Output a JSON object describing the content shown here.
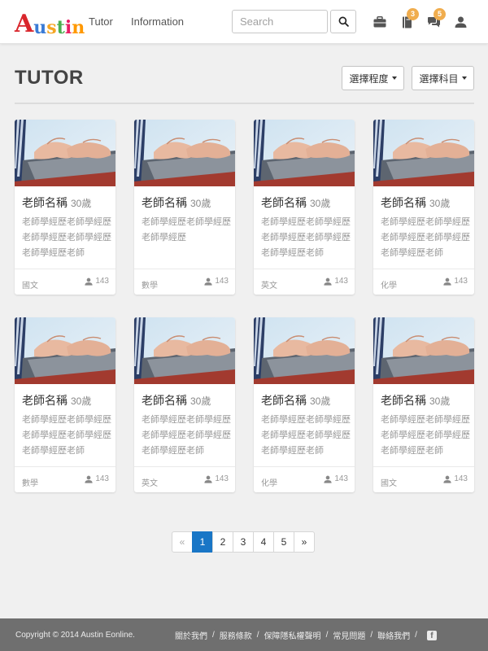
{
  "nav": {
    "logo_letters": [
      "A",
      "u",
      "s",
      "t",
      "i",
      "n"
    ],
    "links": [
      "Tutor",
      "Information"
    ],
    "search_placeholder": "Search",
    "icons": [
      {
        "name": "briefcase-icon",
        "badge": ""
      },
      {
        "name": "book-icon",
        "badge": "3"
      },
      {
        "name": "chat-icon",
        "badge": "5"
      },
      {
        "name": "user-icon",
        "badge": ""
      }
    ]
  },
  "page": {
    "title": "TUTOR",
    "filter_level": "選擇程度",
    "filter_subject": "選擇科目"
  },
  "cards": [
    {
      "name": "老師名稱",
      "age": "30歲",
      "desc": "老師學經歷老師學經歷老師學經歷老師學經歷老師學經歷老師",
      "subject": "國文",
      "count": "143"
    },
    {
      "name": "老師名稱",
      "age": "30歲",
      "desc": "老師學經歷老師學經歷老師學經歷",
      "subject": "數學",
      "count": "143"
    },
    {
      "name": "老師名稱",
      "age": "30歲",
      "desc": "老師學經歷老師學經歷老師學經歷老師學經歷老師學經歷老師",
      "subject": "英文",
      "count": "143"
    },
    {
      "name": "老師名稱",
      "age": "30歲",
      "desc": "老師學經歷老師學經歷老師學經歷老師學經歷老師學經歷老師",
      "subject": "化學",
      "count": "143"
    },
    {
      "name": "老師名稱",
      "age": "30歲",
      "desc": "老師學經歷老師學經歷老師學經歷老師學經歷老師學經歷老師",
      "subject": "數學",
      "count": "143"
    },
    {
      "name": "老師名稱",
      "age": "30歲",
      "desc": "老師學經歷老師學經歷老師學經歷老師學經歷老師學經歷老師",
      "subject": "英文",
      "count": "143"
    },
    {
      "name": "老師名稱",
      "age": "30歲",
      "desc": "老師學經歷老師學經歷老師學經歷老師學經歷老師學經歷老師",
      "subject": "化學",
      "count": "143"
    },
    {
      "name": "老師名稱",
      "age": "30歲",
      "desc": "老師學經歷老師學經歷老師學經歷老師學經歷老師學經歷老師",
      "subject": "國文",
      "count": "143"
    }
  ],
  "pagination": {
    "prev": "«",
    "pages": [
      "1",
      "2",
      "3",
      "4",
      "5"
    ],
    "active": "1",
    "next": "»"
  },
  "footer": {
    "copyright": "Copyright © 2014 Austin Eonline.",
    "links": [
      "關於我們",
      "服務條款",
      "保障隱私權聲明",
      "常見問題",
      "聯絡我們"
    ],
    "separator": "/",
    "facebook_icon": "f"
  },
  "colors": {
    "accent": "#1976c6",
    "badge": "#f0ad4e",
    "footer_bg": "#6f6f6f",
    "page_bg": "#f0f0f0"
  }
}
